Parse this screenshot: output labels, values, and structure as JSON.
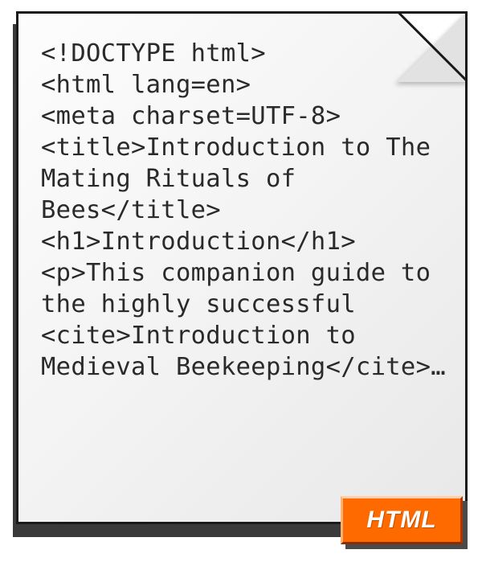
{
  "code_lines": [
    "<!DOCTYPE html>",
    "<html lang=en>",
    "<meta charset=UTF-8>",
    "<title>Introduction to The Mating Rituals of Bees</title>",
    "<h1>Introduction</h1>",
    "<p>This companion guide to the highly successful <cite>Introduction to Medieval Beekeeping</cite>…"
  ],
  "badge": {
    "label": "HTML"
  }
}
